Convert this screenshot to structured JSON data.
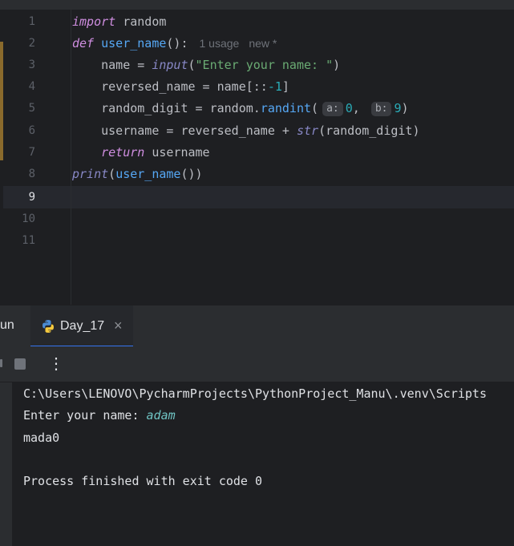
{
  "editor": {
    "line_numbers": [
      "1",
      "2",
      "3",
      "4",
      "5",
      "6",
      "7",
      "8",
      "9",
      "10",
      "11"
    ],
    "current_line": "9",
    "usage_hint": "1 usage",
    "new_hint": "new *",
    "param_hint_a": "a:",
    "param_hint_b": "b:",
    "lines": {
      "l1": {
        "kw": "import",
        "rest": " random"
      },
      "l2": {
        "kw": "def",
        "fn": "user_name",
        "rest": "():"
      },
      "l3": {
        "pre": "    name = ",
        "bi": "input",
        "open": "(",
        "str": "\"Enter your name: \"",
        "close": ")"
      },
      "l4": {
        "pre": "    reversed_name = name[::",
        "num": "-1",
        "close": "]"
      },
      "l5": {
        "pre": "    random_digit = random.",
        "call": "randint",
        "open": "(",
        "a_val": "0",
        "comma": ", ",
        "b_val": "9",
        "close": ")"
      },
      "l6": {
        "pre": "    username = reversed_name + ",
        "bi": "str",
        "rest": "(random_digit)"
      },
      "l7": {
        "indent": "    ",
        "kw": "return",
        "rest": " username"
      },
      "l8": {
        "bi": "print",
        "open": "(",
        "call": "user_name",
        "rest": "())"
      }
    }
  },
  "run_panel": {
    "partial_tab": "un",
    "tab_label": "Day_17",
    "close_glyph": "×",
    "more_glyph": "⋮"
  },
  "console": {
    "path_line": "C:\\Users\\LENOVO\\PycharmProjects\\PythonProject_Manu\\.venv\\Scripts",
    "prompt": "Enter your name: ",
    "user_input": "adam",
    "output": "mada0",
    "exit_message": "Process finished with exit code 0"
  },
  "icons": {
    "tab_icon": "python-icon",
    "stop": "stop-icon",
    "more": "more-vertical-icon"
  },
  "colors": {
    "background": "#1e1f22",
    "keyword": "#cf8ee0",
    "function": "#56a8f5",
    "string": "#6aab73",
    "number": "#2aacb8",
    "accent": "#3574f0"
  }
}
